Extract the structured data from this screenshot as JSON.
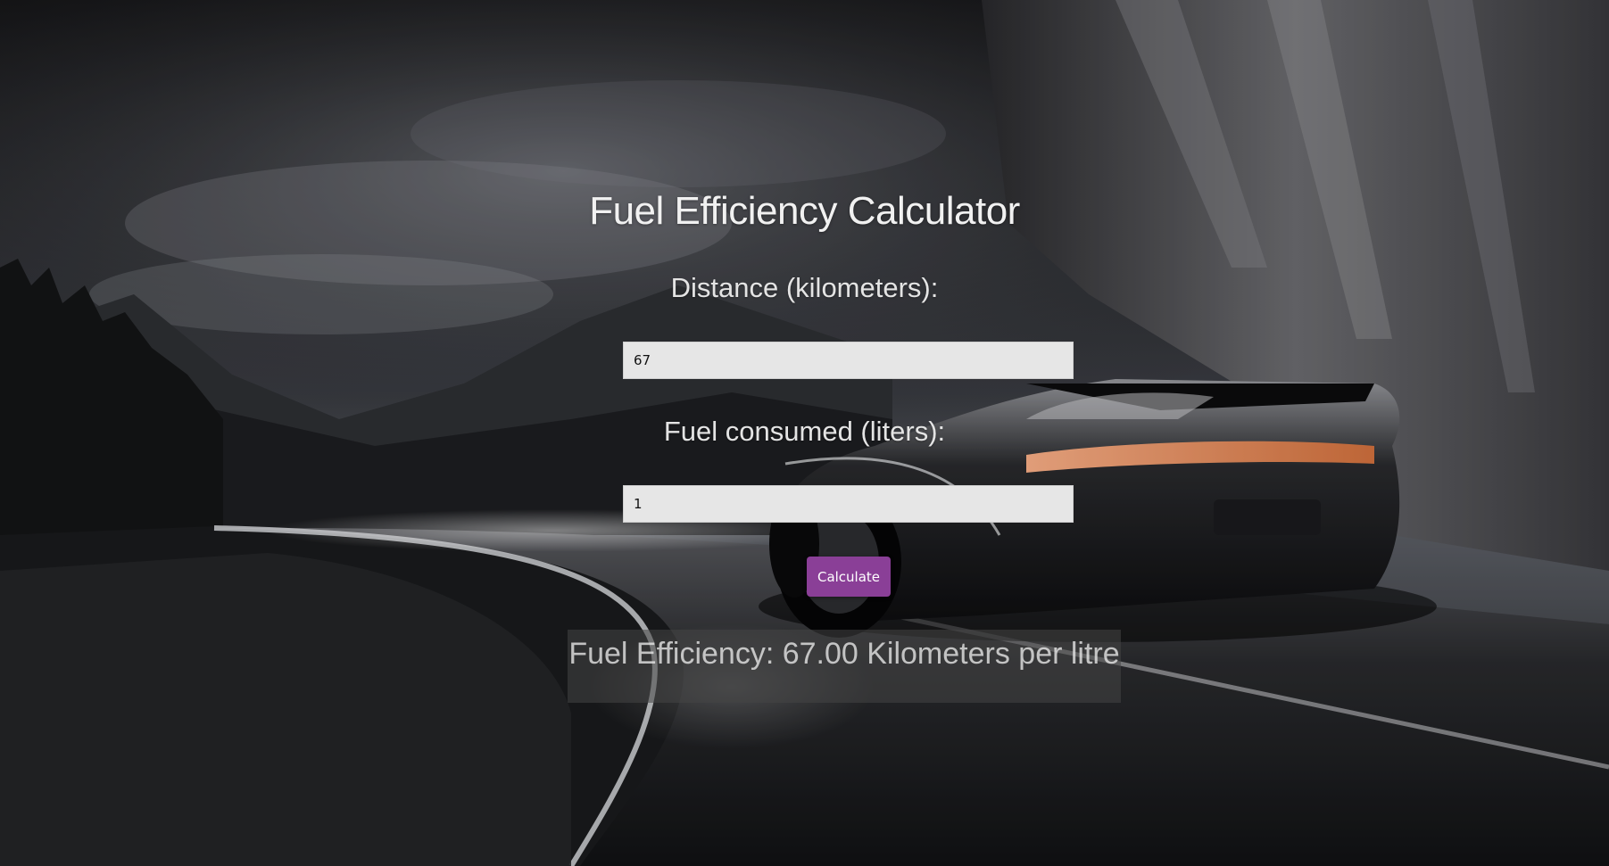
{
  "background": {
    "description_icon": "sports-car-night-road-image",
    "accent_color": "#8a3f97"
  },
  "calculator": {
    "title": "Fuel Efficiency Calculator",
    "distance_label": "Distance (kilometers):",
    "distance_value": "67",
    "fuel_label": "Fuel consumed (liters):",
    "fuel_value": "1",
    "calculate_label": "Calculate",
    "result_text": "Fuel Efficiency: 67.00 Kilometers per litre"
  }
}
